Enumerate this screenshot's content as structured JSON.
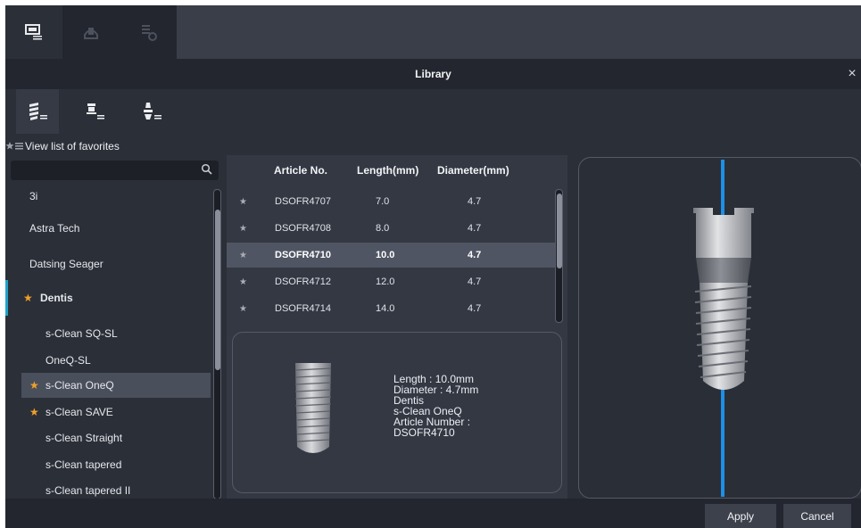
{
  "header": {
    "title": "Library",
    "close_glyph": "×"
  },
  "modebar": {
    "icons": [
      "monitor-list-icon",
      "implant-library-icon",
      "abutment-library-icon"
    ]
  },
  "category_tabs": [
    "implant-list-icon",
    "abutment-list-icon",
    "scanbody-list-icon"
  ],
  "favorites": {
    "label": "View list of favorites"
  },
  "search": {
    "placeholder": "",
    "value": ""
  },
  "manufacturers": [
    {
      "label": "3i",
      "favorite": false
    },
    {
      "label": "Astra Tech",
      "favorite": false
    },
    {
      "label": "Datsing Seager",
      "favorite": false
    },
    {
      "label": "Dentis",
      "favorite": true
    }
  ],
  "products": [
    {
      "label": "s-Clean SQ-SL",
      "favorite": false
    },
    {
      "label": "OneQ-SL",
      "favorite": false
    },
    {
      "label": "s-Clean OneQ",
      "favorite": true,
      "selected": true
    },
    {
      "label": "s-Clean SAVE",
      "favorite": true
    },
    {
      "label": "s-Clean Straight",
      "favorite": false
    },
    {
      "label": "s-Clean tapered",
      "favorite": false
    },
    {
      "label": "s-Clean tapered II",
      "favorite": false
    }
  ],
  "table": {
    "headers": {
      "article": "Article No.",
      "length": "Length(mm)",
      "diameter": "Diameter(mm)"
    },
    "rows": [
      {
        "star": "★",
        "article": "DSOFR4707",
        "length": "7.0",
        "diameter": "4.7"
      },
      {
        "star": "★",
        "article": "DSOFR4708",
        "length": "8.0",
        "diameter": "4.7"
      },
      {
        "star": "★",
        "article": "DSOFR4710",
        "length": "10.0",
        "diameter": "4.7",
        "selected": true
      },
      {
        "star": "★",
        "article": "DSOFR4712",
        "length": "12.0",
        "diameter": "4.7"
      },
      {
        "star": "★",
        "article": "DSOFR4714",
        "length": "14.0",
        "diameter": "4.7"
      }
    ]
  },
  "detail": {
    "length": "Length : 10.0mm",
    "diameter": "Diameter : 4.7mm",
    "manufacturer": "Dentis",
    "product": "s-Clean OneQ",
    "article_label": "Article Number :",
    "article_value": "DSOFR4710"
  },
  "footer": {
    "apply": "Apply",
    "cancel": "Cancel"
  },
  "colors": {
    "accent": "#1fa2c9",
    "favorite_star": "#f0a02a",
    "axis": "#1f8fe6"
  }
}
